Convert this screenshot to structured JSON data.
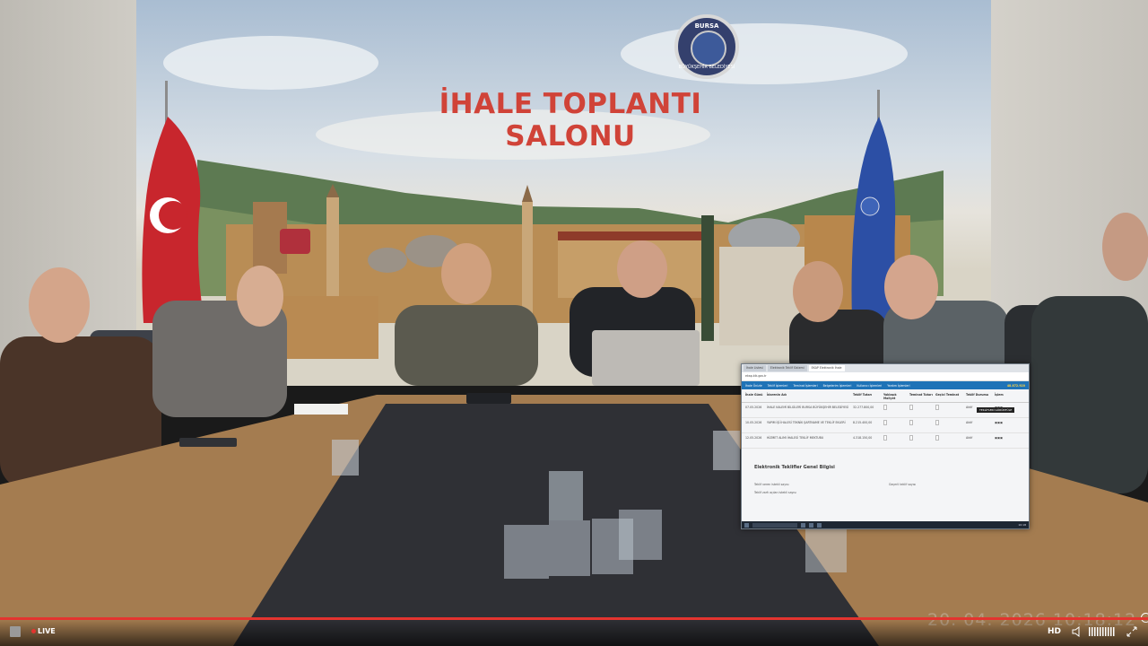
{
  "window": {
    "title": "İHALE TOPLANTI SALONU"
  },
  "room": {
    "logo_text": "BURSA",
    "logo_subtext": "BÜYÜKŞEHİR BELEDİYESİ",
    "hall_title": "İHALE TOPLANTI SALONU"
  },
  "screen_capture": {
    "tabs": [
      "İhale Listesi",
      "Elektronik Teklif Sistemi",
      "EKAP Elektronik İhale"
    ],
    "nav_items": [
      "İhale Önizle",
      "Teklif İşlemleri",
      "Teminat İşlemleri",
      "Belgelerim İşlemleri",
      "Kullanıcı İşlemleri",
      "Yardım İşlemleri"
    ],
    "highlight_amount": "48.872.920",
    "columns": [
      "İhale Günü",
      "İdarenin Adı",
      "Teklif Tutarı",
      "Yaklaşık Maliyet",
      "Teminat Tutarı",
      "Geçici Teminat",
      "Teklif Durumu",
      "İşlem"
    ],
    "rows": [
      {
        "date": "07.05.2026",
        "name": "İHALE KALEMİ BİLGİLERİ BURSA BÜYÜKŞEHİR BELEDİYESİ",
        "amount": "32.277.800,00",
        "status": "Aktif"
      },
      {
        "date": "10.05.2026",
        "name": "YAPIM İŞİ İHALESİ TEKNİK ŞARTNAME VE TEKLİF EKLERİ",
        "amount": "8.215.400,00",
        "status": "Aktif"
      },
      {
        "date": "12.05.2026",
        "name": "HİZMET ALIMI İHALESİ TEKLİF MEKTUBU",
        "amount": "4.318.150,00",
        "status": "Aktif"
      }
    ],
    "tooltip": "TEKLİFLERİ GÖRÜNTÜLE",
    "section_title": "Elektronik Teklifler Genel Bilgisi",
    "summary": [
      "Teklif veren istekli sayısı",
      "Teklif zarfı açılan istekli sayısı",
      "Geçerli teklif sayısı"
    ],
    "taskbar_time": "10:18"
  },
  "overlay": {
    "timestamp": "20. 04. 2026 10:18:12"
  },
  "player": {
    "live_label": "LIVE",
    "hd_label": "HD",
    "progress_fraction": 1.0,
    "accent_color": "#e3342f",
    "icons": [
      "stop-icon",
      "volume-icon",
      "signal-bars-icon",
      "fullscreen-icon"
    ]
  }
}
